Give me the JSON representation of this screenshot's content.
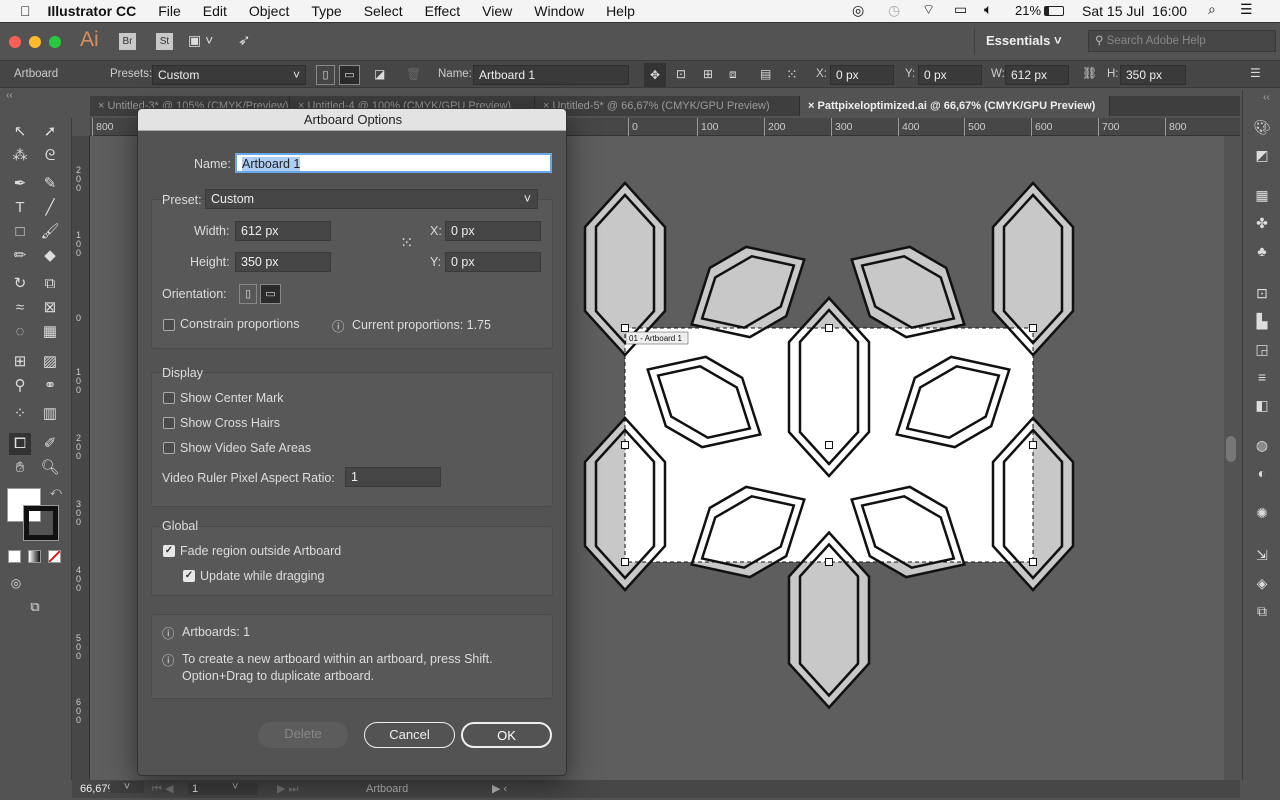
{
  "menubar": {
    "app": "Illustrator CC",
    "items": [
      "File",
      "Edit",
      "Object",
      "Type",
      "Select",
      "Effect",
      "View",
      "Window",
      "Help"
    ],
    "battery": "21%",
    "datetime": "Sat 15 Jul  16:00"
  },
  "appbar": {
    "logo": "Ai",
    "bridge": "Br",
    "stock": "St",
    "workspace": "Essentials",
    "search_placeholder": "Search Adobe Help"
  },
  "control": {
    "tool": "Artboard",
    "presets_label": "Presets:",
    "presets_value": "Custom",
    "name_label": "Name:",
    "name_value": "Artboard 1",
    "x_label": "X:",
    "x": "0 px",
    "y_label": "Y:",
    "y": "0 px",
    "w_label": "W:",
    "w": "612 px",
    "h_label": "H:",
    "h": "350 px"
  },
  "tabs": [
    {
      "label": "Untitled-3* @ 105% (CMYK/Preview)"
    },
    {
      "label": "Untitled-4 @ 100% (CMYK/GPU Preview)"
    },
    {
      "label": "Untitled-5* @ 66,67% (CMYK/GPU Preview)"
    },
    {
      "label": "Pattpixeloptimized.ai @ 66,67% (CMYK/GPU Preview)",
      "active": true
    }
  ],
  "ruler_h": [
    "800",
    "0",
    "100",
    "200",
    "300",
    "400",
    "500",
    "600",
    "700",
    "800"
  ],
  "ruler_v": [
    "200",
    "100",
    "0",
    "100",
    "200",
    "300",
    "400",
    "500",
    "600"
  ],
  "artboard_label": "01 - Artboard 1",
  "dialog": {
    "title": "Artboard Options",
    "name_label": "Name:",
    "name_value": "Artboard 1",
    "preset_label": "Preset:",
    "preset_value": "Custom",
    "width_label": "Width:",
    "width_value": "612 px",
    "height_label": "Height:",
    "height_value": "350 px",
    "x_label": "X:",
    "x_value": "0 px",
    "y_label": "Y:",
    "y_value": "0 px",
    "orientation_label": "Orientation:",
    "constrain_label": "Constrain proportions",
    "constrain_checked": false,
    "proportions": "Current proportions: 1.75",
    "display_heading": "Display",
    "center_mark": "Show Center Mark",
    "cross_hairs": "Show Cross Hairs",
    "video_safe": "Show Video Safe Areas",
    "par_label": "Video Ruler Pixel Aspect Ratio:",
    "par_value": "1",
    "global_heading": "Global",
    "fade_label": "Fade region outside Artboard",
    "fade_checked": true,
    "update_label": "Update while dragging",
    "update_checked": true,
    "artboards_count": "Artboards: 1",
    "tip_line1": "To create a new artboard within an artboard, press Shift.",
    "tip_line2": "Option+Drag to duplicate artboard.",
    "delete_label": "Delete",
    "cancel_label": "Cancel",
    "ok_label": "OK"
  },
  "status": {
    "zoom": "66,67%",
    "page": "1",
    "tool": "Artboard"
  },
  "colors": {
    "accent": "#4a90d9",
    "ui_bg": "#535353",
    "artwork_fill": "#c8c8c8"
  }
}
